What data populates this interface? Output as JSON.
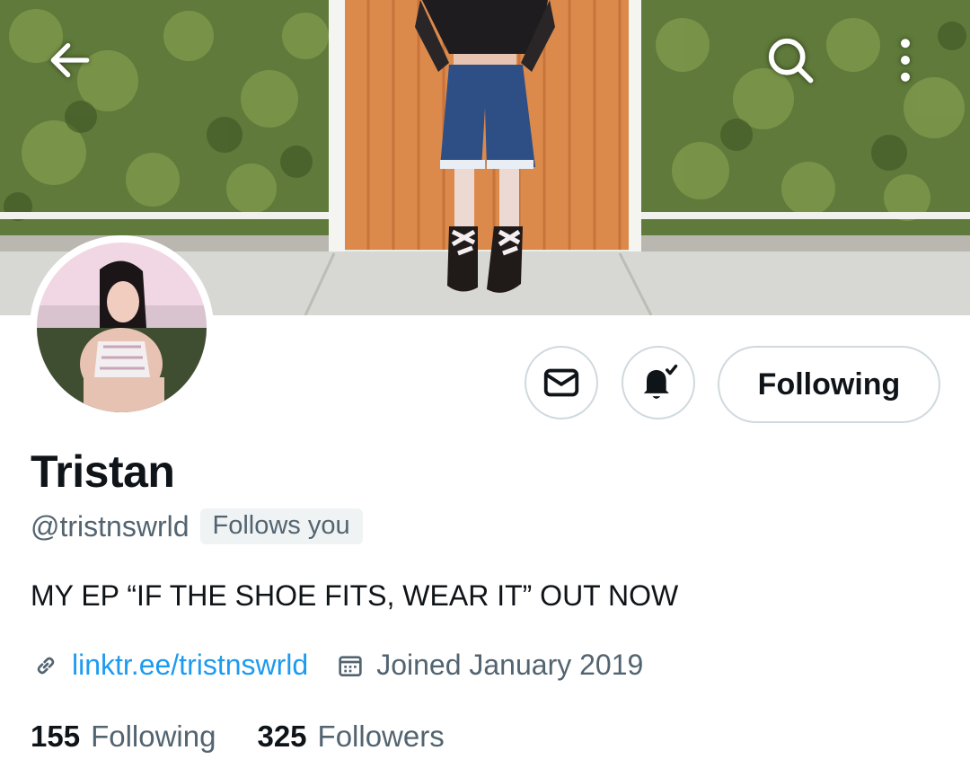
{
  "colors": {
    "accent": "#1d9bf0",
    "text_primary": "#0f1419",
    "text_secondary": "#536471",
    "border": "#cfd9de"
  },
  "header": {
    "back_icon": "arrow-left-icon",
    "search_icon": "search-icon",
    "more_icon": "more-vertical-icon"
  },
  "profile": {
    "name": "Tristan",
    "handle": "@tristnswrld",
    "follows_you": "Follows you",
    "bio": "MY EP “IF THE SHOE FITS, WEAR IT” OUT NOW",
    "link": "linktr.ee/tristnswrld",
    "joined": "Joined January 2019"
  },
  "actions": {
    "message_icon": "mail-icon",
    "notifications_icon": "bell-check-icon",
    "follow_label": "Following"
  },
  "stats": {
    "following_count": "155",
    "following_label": "Following",
    "followers_count": "325",
    "followers_label": "Followers"
  }
}
